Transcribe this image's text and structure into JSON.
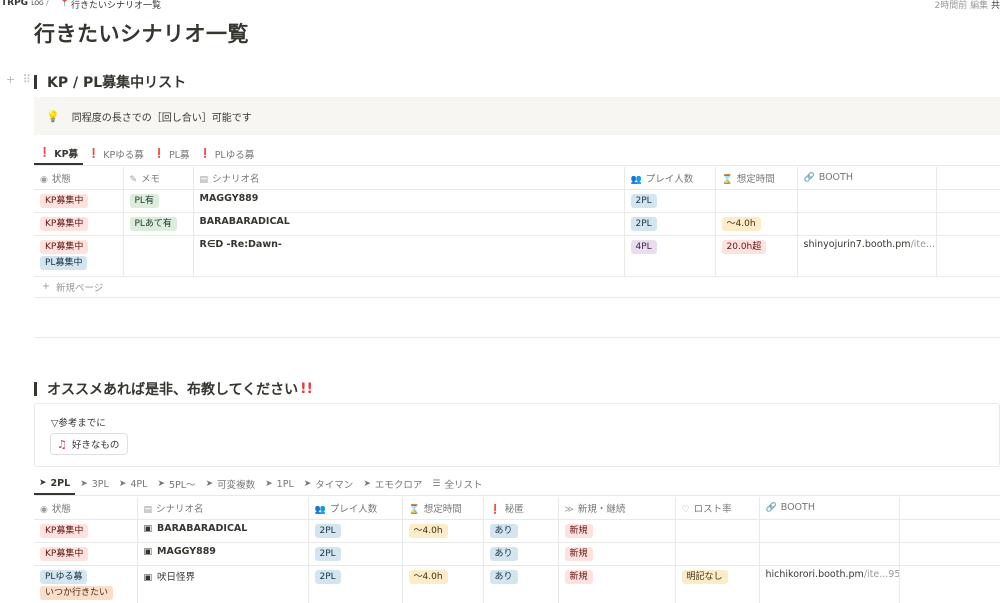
{
  "topbar": {
    "root": "TRPG",
    "root_small": "LOG",
    "separator": "/",
    "page": "行きたいシナリオ一覧",
    "edited": "2時間前 編集",
    "share": "共"
  },
  "page_title": "行きたいシナリオ一覧",
  "section1": {
    "heading": "KP / PL募集中リスト",
    "callout": "同程度の長さでの［回し合い］可能です",
    "tabs": [
      {
        "label": "KP募",
        "icon": "alert-icon"
      },
      {
        "label": "KPゆる募",
        "icon": "alert-icon"
      },
      {
        "label": "PL募",
        "icon": "alert-icon"
      },
      {
        "label": "PLゆる募",
        "icon": "alert-icon"
      }
    ],
    "columns": [
      "状態",
      "メモ",
      "シナリオ名",
      "プレイ人数",
      "想定時間",
      "BOOTH"
    ],
    "rows": [
      {
        "status": [
          "KP募集中"
        ],
        "memo": "PL有",
        "title": "MAGGY889",
        "players": "2PL",
        "time": "",
        "booth": "",
        "booth_dim": ""
      },
      {
        "status": [
          "KP募集中"
        ],
        "memo": "PLあて有",
        "title": "BARABARADICAL",
        "players": "2PL",
        "time": "〜4.0h",
        "booth": "",
        "booth_dim": ""
      },
      {
        "status": [
          "KP募集中",
          "PL募集中"
        ],
        "memo": "",
        "title": "R∈D -Re:Dawn-",
        "players": "4PL",
        "time": "20.0h超",
        "booth": "shinyojurin7.booth.pm",
        "booth_dim": "/ite...177"
      }
    ],
    "new_page": "新規ページ"
  },
  "section2": {
    "heading": "オススメあれば是非、布教してください",
    "heading_mark": "!!",
    "toggle": "▽参考までに",
    "chip": "好きなもの",
    "tabs": [
      {
        "label": "2PL",
        "icon": "arrow-icon"
      },
      {
        "label": "3PL",
        "icon": "arrow-icon"
      },
      {
        "label": "4PL",
        "icon": "arrow-icon"
      },
      {
        "label": "5PL〜",
        "icon": "arrow-icon"
      },
      {
        "label": "可変複数",
        "icon": "arrow-icon"
      },
      {
        "label": "1PL",
        "icon": "arrow-icon"
      },
      {
        "label": "タイマン",
        "icon": "arrow-icon"
      },
      {
        "label": "エモクロア",
        "icon": "arrow-icon"
      },
      {
        "label": "全リスト",
        "icon": "list-icon"
      }
    ],
    "columns": [
      "状態",
      "シナリオ名",
      "プレイ人数",
      "想定時間",
      "秘匿",
      "新規・継続",
      "ロスト率",
      "BOOTH"
    ],
    "rows": [
      {
        "status": [
          "KP募集中"
        ],
        "title": "BARABARADICAL",
        "players": "2PL",
        "time": "〜4.0h",
        "secret": "あり",
        "newcont": "新規",
        "lost": "",
        "booth": "",
        "booth_dim": ""
      },
      {
        "status": [
          "KP募集中"
        ],
        "title": "MAGGY889",
        "players": "2PL",
        "time": "",
        "secret": "あり",
        "newcont": "新規",
        "lost": "",
        "booth": "",
        "booth_dim": ""
      },
      {
        "status": [
          "PLゆる募",
          "いつか行きたい"
        ],
        "title": "吠日怪界",
        "players": "2PL",
        "time": "〜4.0h",
        "secret": "あり",
        "newcont": "新規",
        "lost": "明記なし",
        "booth": "hichikorori.booth.pm",
        "booth_dim": "/ite...9558"
      }
    ]
  },
  "colors": {
    "text": "#37352f",
    "muted": "#787774",
    "accent_red": "#e03e3e"
  }
}
